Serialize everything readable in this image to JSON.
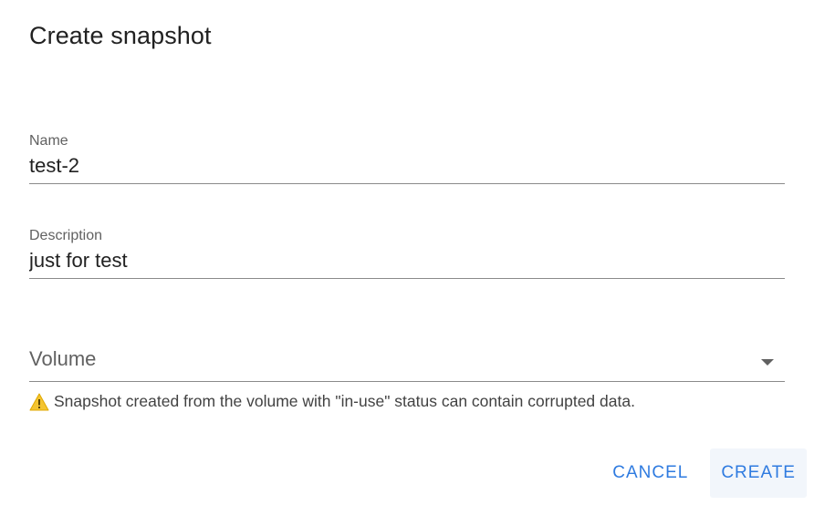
{
  "dialog": {
    "title": "Create snapshot",
    "fields": {
      "name": {
        "label": "Name",
        "value": "test-2"
      },
      "description": {
        "label": "Description",
        "value": "just for test"
      },
      "volume": {
        "placeholder": "Volume",
        "selected": ""
      }
    },
    "warning": {
      "icon": "warning-icon",
      "icon_color": "#f4c430",
      "text": "Snapshot created from the volume with \"in-use\" status can contain corrupted data."
    },
    "actions": {
      "cancel_label": "CANCEL",
      "create_label": "CREATE",
      "accent_color": "#2f7be0"
    }
  }
}
